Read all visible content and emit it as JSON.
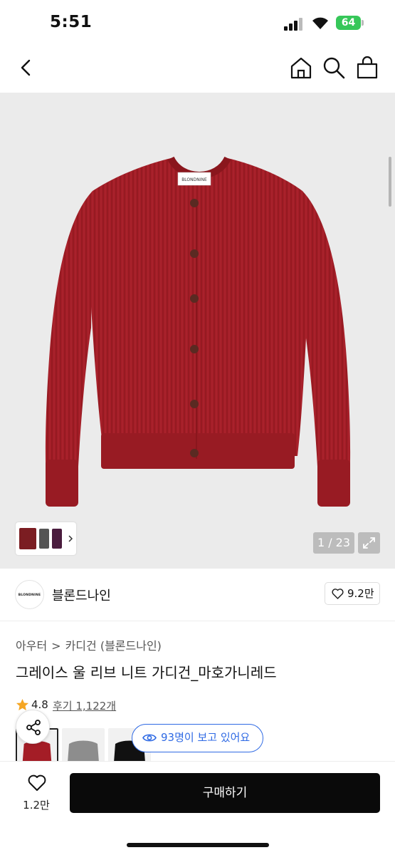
{
  "status_bar": {
    "time": "5:51",
    "battery": "64"
  },
  "icons": {
    "back": "chevron-left-icon",
    "home": "home-icon",
    "search": "search-icon",
    "bag": "shopping-bag-icon",
    "share": "share-icon",
    "heart": "heart-icon",
    "eye": "eye-icon",
    "star": "star-icon",
    "expand": "expand-icon"
  },
  "gallery": {
    "counter": "1 / 23"
  },
  "brand": {
    "logo_text": "BLONDNINE",
    "name": "블론드나인",
    "likes": "9.2만"
  },
  "product": {
    "breadcrumb": [
      "아우터",
      "카디건 (블론드나인)"
    ],
    "title": "그레이스 울 리브 니트 가디건_마호가니레드",
    "rating": "4.8",
    "reviews": "후기 1,122개",
    "viewing": "93명이 보고 있어요"
  },
  "bottom_bar": {
    "wish_count": "1.2만",
    "buy_label": "구매하기"
  },
  "colors": {
    "garment": "#a41d26",
    "accent_blue": "#2f6ae4",
    "buy_button": "#0a0a0a",
    "star": "#f5a623"
  }
}
